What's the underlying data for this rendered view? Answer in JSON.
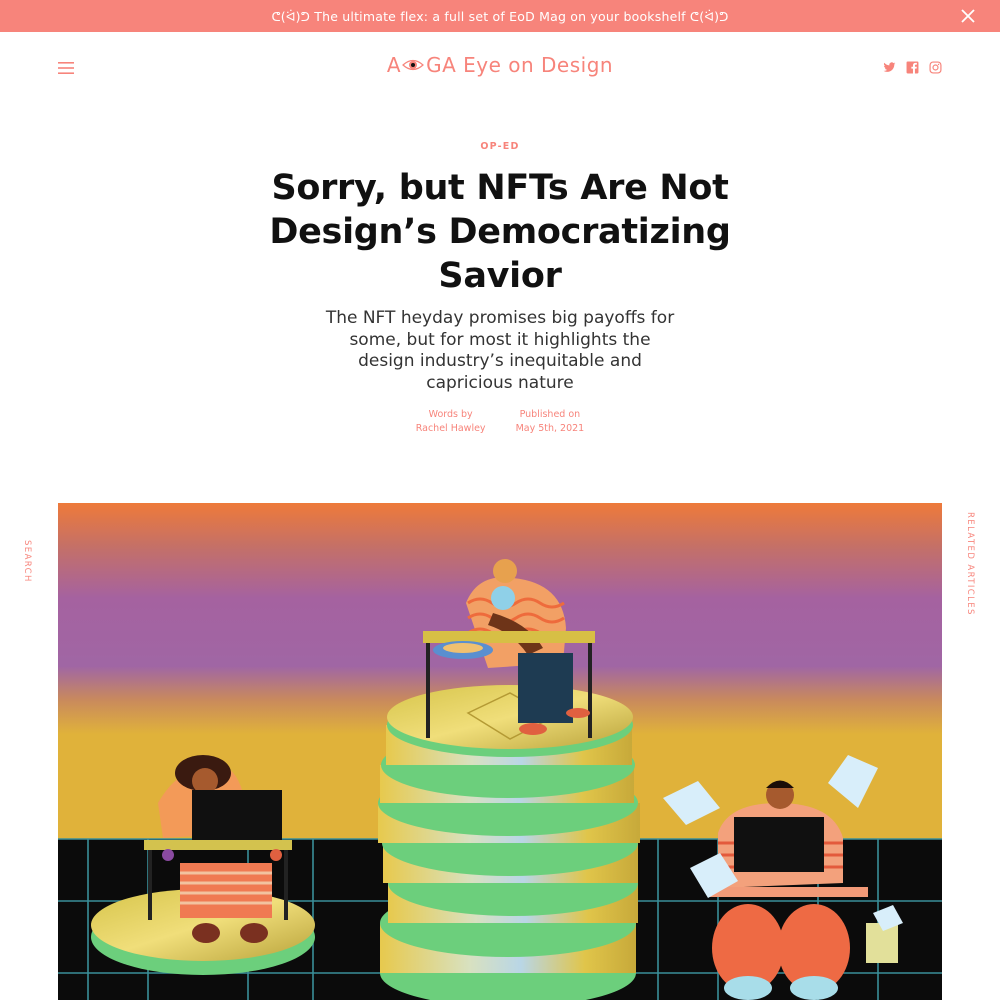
{
  "promo": {
    "text": "ᕦ(ᐛ)ᕤ The ultimate flex: a full set of EoD Mag on your bookshelf ᕦ(ᐛ)ᕤ"
  },
  "header": {
    "logo_left": "A",
    "logo_right": "GA Eye on Design",
    "social": [
      "twitter-icon",
      "facebook-icon",
      "instagram-icon"
    ]
  },
  "article": {
    "category": "OP-ED",
    "title_lines": [
      "Sorry, but NFTs Are Not",
      "Design’s Democratizing",
      "Savior"
    ],
    "subtitle_lines": [
      "The NFT heyday promises big payoffs for",
      "some, but for most it highlights the",
      "design industry’s inequitable and",
      "capricious nature"
    ],
    "author_label": "Words by",
    "author": "Rachel Hawley",
    "date_label": "Published on",
    "date": "May 5th, 2021"
  },
  "side": {
    "search": "SEARCH",
    "related": "RELATED ARTICLES"
  },
  "colors": {
    "accent": "#f7847b",
    "text": "#111111"
  }
}
